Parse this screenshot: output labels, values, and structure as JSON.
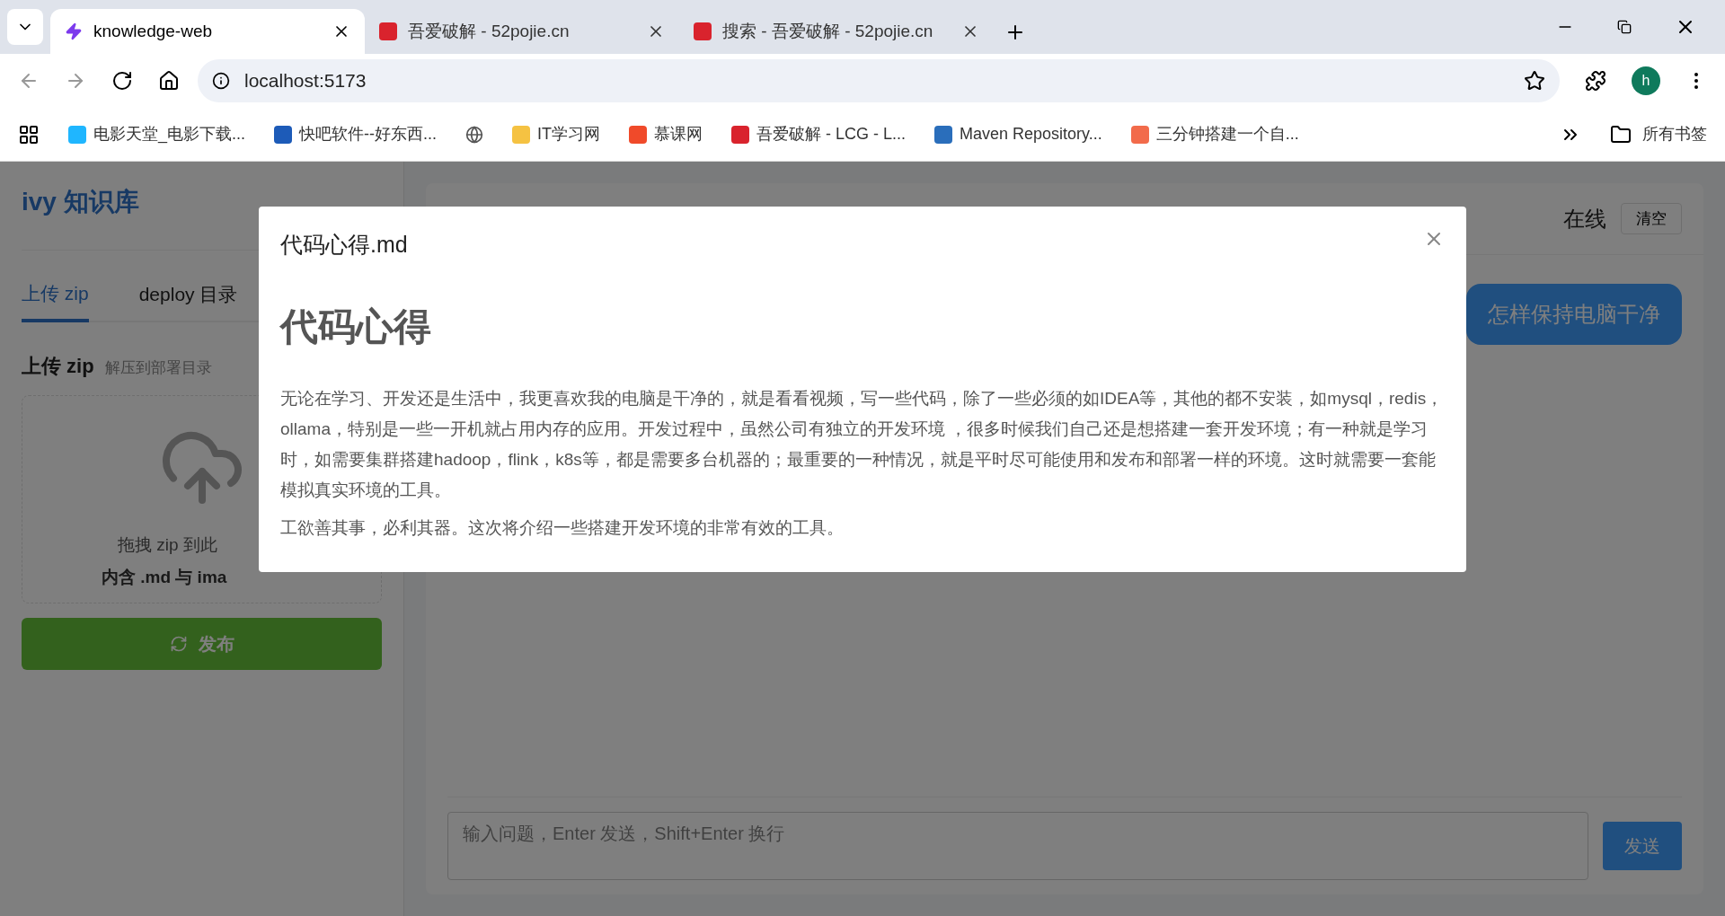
{
  "browser": {
    "tabs": [
      {
        "kind": "lightning",
        "title": "knowledge-web",
        "selected": true
      },
      {
        "kind": "square",
        "title": "吾爱破解 - 52pojie.cn",
        "selected": false
      },
      {
        "kind": "square",
        "title": "搜索 - 吾爱破解 - 52pojie.cn",
        "selected": false
      }
    ],
    "address": "localhost:5173",
    "profile": "h",
    "bookmarks": [
      {
        "kind": "favicon",
        "color": "#1fb6ff",
        "label": "电影天堂_电影下载..."
      },
      {
        "kind": "favicon",
        "color": "#1d5bb8",
        "label": "快吧软件--好东西..."
      },
      {
        "kind": "globe"
      },
      {
        "kind": "favicon",
        "color": "#f5c242",
        "label": "IT学习网"
      },
      {
        "kind": "favicon",
        "color": "#f04a2a",
        "label": "慕课网"
      },
      {
        "kind": "favicon",
        "color": "#d9232d",
        "label": "吾爱破解 - LCG - L..."
      },
      {
        "kind": "favicon",
        "color": "#2a6ebb",
        "label": "Maven Repository..."
      },
      {
        "kind": "favicon",
        "color": "#f26b4b",
        "label": "三分钟搭建一个自..."
      }
    ],
    "all_bookmarks": "所有书签"
  },
  "sidebar": {
    "title": "ivy 知识库",
    "tabs": [
      {
        "label": "上传 zip",
        "selected": true
      },
      {
        "label": "deploy 目录",
        "selected": false
      }
    ],
    "section_title": "上传 zip",
    "section_hint": "解压到部署目录",
    "drop_text": "拖拽 zip 到此",
    "drop_hint": "内含 .md 与 ima",
    "publish_button": "发布"
  },
  "chat": {
    "status": "在线",
    "clear_button": "清空",
    "messages": [
      {
        "kind": "user",
        "text": "怎样保持电脑干净"
      }
    ],
    "input_placeholder": "输入问题，Enter 发送，Shift+Enter 换行",
    "send_button": "发送"
  },
  "modal": {
    "title": "代码心得.md",
    "heading": "代码心得",
    "paragraphs": [
      "无论在学习、开发还是生活中，我更喜欢我的电脑是干净的，就是看看视频，写一些代码，除了一些必须的如IDEA等，其他的都不安装，如mysql，redis，ollama，特别是一些一开机就占用内存的应用。开发过程中，虽然公司有独立的开发环境 ，很多时候我们自己还是想搭建一套开发环境；有一种就是学习时，如需要集群搭建hadoop，flink，k8s等，都是需要多台机器的；最重要的一种情况，就是平时尽可能使用和发布和部署一样的环境。这时就需要一套能模拟真实环境的工具。",
      "工欲善其事，必利其器。这次将介绍一些搭建开发环境的非常有效的工具。"
    ]
  }
}
